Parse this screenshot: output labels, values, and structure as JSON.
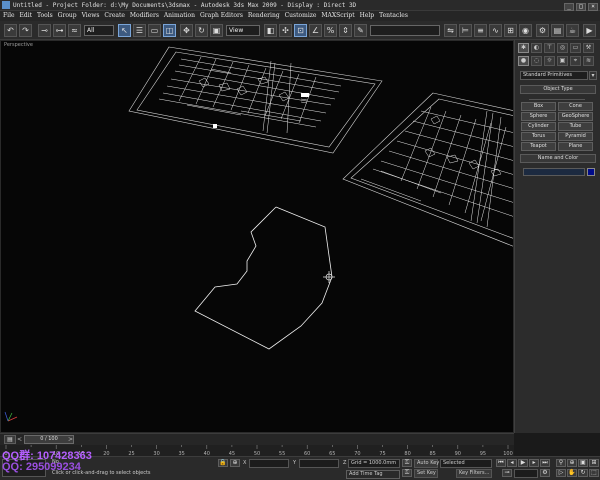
{
  "titlebar": {
    "text": "Untitled      - Project Folder: d:\\My Documents\\3dsmax      - Autodesk 3ds Max  2009      - Display : Direct 3D",
    "min": "_",
    "max": "□",
    "close": "×"
  },
  "menu": [
    "File",
    "Edit",
    "Tools",
    "Group",
    "Views",
    "Create",
    "Modifiers",
    "Animation",
    "Graph Editors",
    "Rendering",
    "Customize",
    "MAXScript",
    "Help",
    "Tentacles"
  ],
  "toolbar": {
    "selection_filter": "All",
    "coord_system": "View"
  },
  "viewport": {
    "label": "Perspective"
  },
  "command_panel": {
    "category": "Standard Primitives",
    "object_type_title": "Object Type",
    "autogrid": "",
    "primitives": [
      "Box",
      "Cone",
      "Sphere",
      "GeoSphere",
      "Cylinder",
      "Tube",
      "Torus",
      "Pyramid",
      "Teapot",
      "Plane"
    ],
    "name_and_color_title": "Name and Color",
    "object_color": "#000b8a"
  },
  "timeline": {
    "frame_display": "0 / 100",
    "ticks": [
      "0",
      "10",
      "15",
      "20",
      "25",
      "30",
      "35",
      "40",
      "45",
      "50",
      "55",
      "60",
      "65",
      "70",
      "75",
      "80",
      "85",
      "90",
      "95",
      "100"
    ]
  },
  "statusbar": {
    "selection_count": "No",
    "prompt": "Click or click-and-drag to select objects",
    "x_label": "X",
    "y_label": "Y",
    "z_label": "Z",
    "grid": "Grid = 1000.0mm",
    "add_time_tag": "Add Time Tag",
    "auto_key": "Auto Key",
    "set_key": "Set Key",
    "key_mode": "Selected",
    "key_filters": "Key Filters..."
  },
  "overlay": {
    "qq_line1": "QQ群: 107428363",
    "qq_line2": "QQ: 295099234"
  }
}
